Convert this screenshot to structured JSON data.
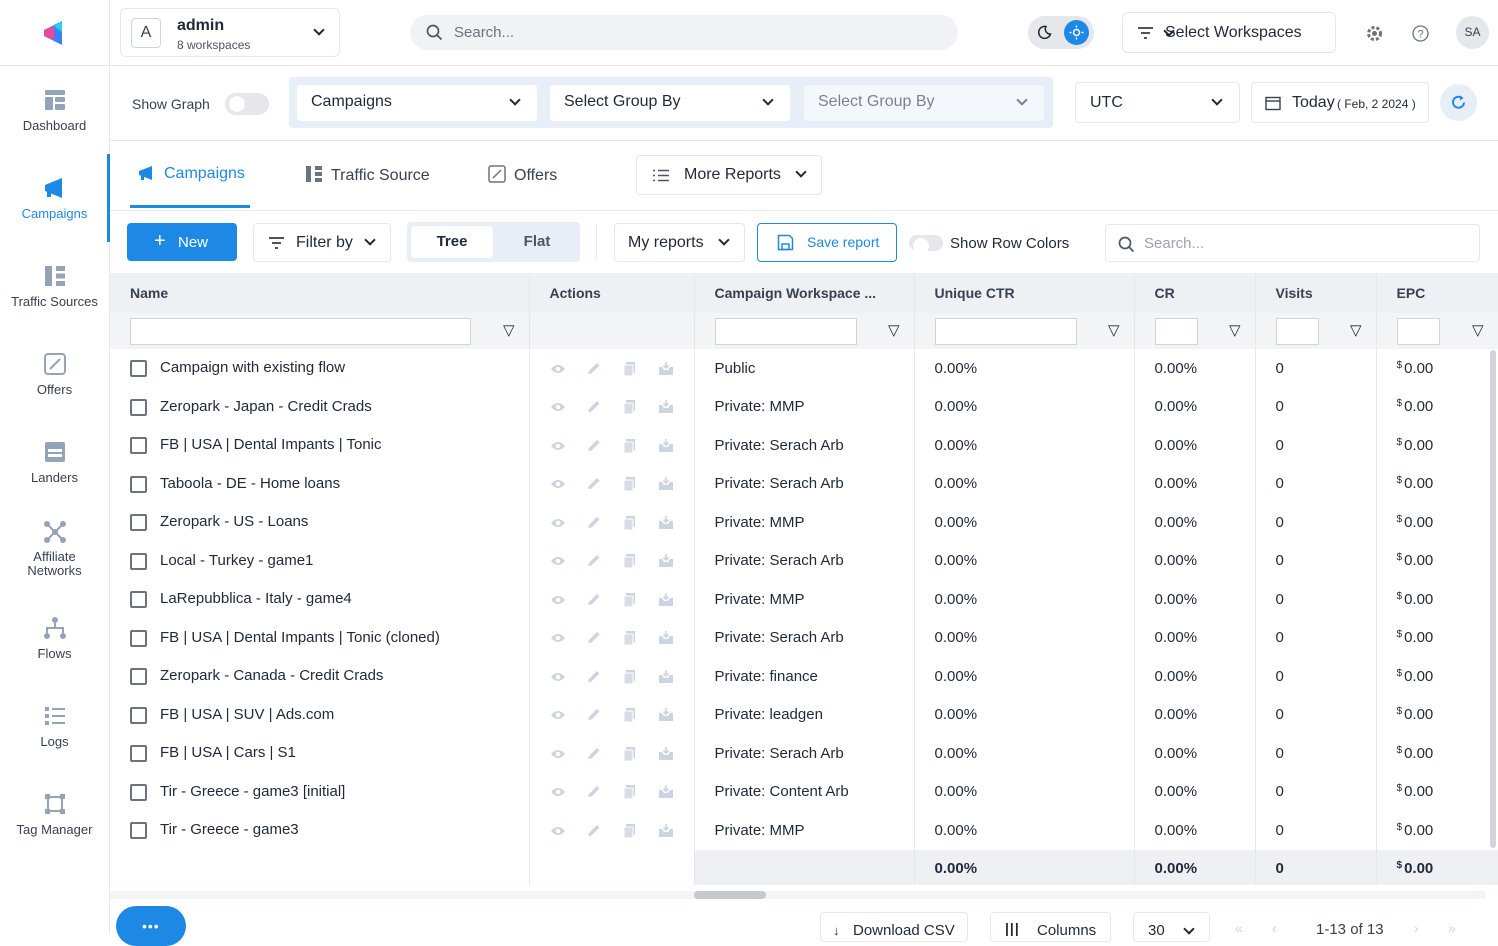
{
  "sidebar": {
    "items": [
      {
        "label": "Dashboard",
        "icon": "dashboard-icon"
      },
      {
        "label": "Campaigns",
        "icon": "megaphone-icon"
      },
      {
        "label": "Traffic Sources",
        "icon": "traffic-sources-icon"
      },
      {
        "label": "Offers",
        "icon": "offers-icon"
      },
      {
        "label": "Landers",
        "icon": "landers-icon"
      },
      {
        "label": "Affiliate Networks",
        "icon": "network-icon"
      },
      {
        "label": "Flows",
        "icon": "flows-icon"
      },
      {
        "label": "Logs",
        "icon": "logs-icon"
      },
      {
        "label": "Tag Manager",
        "icon": "tag-manager-icon"
      }
    ],
    "active": "Campaigns"
  },
  "header": {
    "account_initial": "A",
    "account_name": "admin",
    "account_sub": "8 workspaces",
    "search_placeholder": "Search...",
    "workspaces_label": "Select Workspaces",
    "avatar": "SA"
  },
  "filters": {
    "show_graph": "Show Graph",
    "group1": "Campaigns",
    "group2": "Select Group By",
    "group3": "Select Group By",
    "timezone": "UTC",
    "date_label": "Today",
    "date_value": "( Feb, 2 2024 )"
  },
  "tabs": [
    {
      "label": "Campaigns",
      "icon": "megaphone-icon"
    },
    {
      "label": "Traffic Source",
      "icon": "traffic-sources-icon"
    },
    {
      "label": "Offers",
      "icon": "offers-icon"
    }
  ],
  "more_reports": "More Reports",
  "toolbar": {
    "new": "New",
    "filter_by": "Filter by",
    "tree": "Tree",
    "flat": "Flat",
    "my_reports": "My reports",
    "save_report": "Save report",
    "show_row_colors": "Show Row Colors",
    "search_placeholder": "Search..."
  },
  "table": {
    "columns": [
      "Name",
      "Actions",
      "Campaign Workspace ...",
      "Unique CTR",
      "CR",
      "Visits",
      "EPC"
    ],
    "rows": [
      {
        "name": "Campaign with existing flow",
        "workspace": "Public",
        "ctr": "0.00%",
        "cr": "0.00%",
        "visits": "0",
        "epc": "0.00"
      },
      {
        "name": "Zeropark - Japan - Credit Crads",
        "workspace": "Private: MMP",
        "ctr": "0.00%",
        "cr": "0.00%",
        "visits": "0",
        "epc": "0.00"
      },
      {
        "name": "FB | USA | Dental Impants | Tonic",
        "workspace": "Private: Serach Arb",
        "ctr": "0.00%",
        "cr": "0.00%",
        "visits": "0",
        "epc": "0.00"
      },
      {
        "name": "Taboola - DE - Home loans",
        "workspace": "Private: Serach Arb",
        "ctr": "0.00%",
        "cr": "0.00%",
        "visits": "0",
        "epc": "0.00"
      },
      {
        "name": "Zeropark - US - Loans",
        "workspace": "Private: MMP",
        "ctr": "0.00%",
        "cr": "0.00%",
        "visits": "0",
        "epc": "0.00"
      },
      {
        "name": "Local - Turkey - game1",
        "workspace": "Private: Serach Arb",
        "ctr": "0.00%",
        "cr": "0.00%",
        "visits": "0",
        "epc": "0.00"
      },
      {
        "name": "LaRepubblica - Italy - game4",
        "workspace": "Private: MMP",
        "ctr": "0.00%",
        "cr": "0.00%",
        "visits": "0",
        "epc": "0.00"
      },
      {
        "name": "FB | USA | Dental Impants | Tonic (cloned)",
        "workspace": "Private: Serach Arb",
        "ctr": "0.00%",
        "cr": "0.00%",
        "visits": "0",
        "epc": "0.00"
      },
      {
        "name": "Zeropark - Canada - Credit Crads",
        "workspace": "Private: finance",
        "ctr": "0.00%",
        "cr": "0.00%",
        "visits": "0",
        "epc": "0.00"
      },
      {
        "name": "FB | USA | SUV | Ads.com",
        "workspace": "Private: leadgen",
        "ctr": "0.00%",
        "cr": "0.00%",
        "visits": "0",
        "epc": "0.00"
      },
      {
        "name": "FB | USA | Cars | S1",
        "workspace": "Private: Serach Arb",
        "ctr": "0.00%",
        "cr": "0.00%",
        "visits": "0",
        "epc": "0.00"
      },
      {
        "name": "Tir - Greece - game3 [initial]",
        "workspace": "Private: Content Arb",
        "ctr": "0.00%",
        "cr": "0.00%",
        "visits": "0",
        "epc": "0.00"
      },
      {
        "name": "Tir - Greece - game3",
        "workspace": "Private: MMP",
        "ctr": "0.00%",
        "cr": "0.00%",
        "visits": "0",
        "epc": "0.00"
      }
    ],
    "totals": {
      "ctr": "0.00%",
      "cr": "0.00%",
      "visits": "0",
      "epc": "0.00"
    },
    "currency": "$"
  },
  "footer": {
    "download": "Download CSV",
    "columns": "Columns",
    "page_size": "30",
    "range": "1-13 of 13"
  },
  "colors": {
    "accent": "#1e88e5",
    "header_bg": "#eef0f4"
  }
}
